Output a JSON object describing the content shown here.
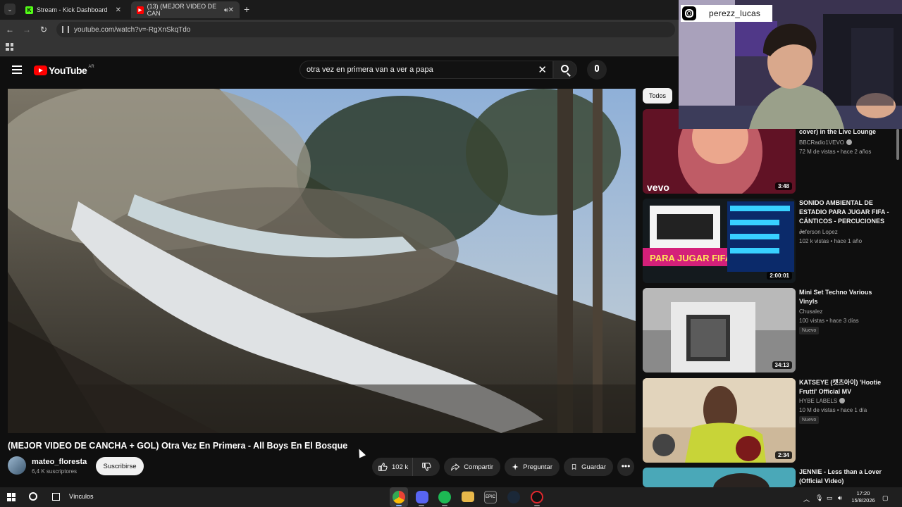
{
  "browser": {
    "tabs": [
      {
        "title": "Stream - Kick Dashboard",
        "favicon": "K",
        "active": false
      },
      {
        "title": "(13) (MEJOR VIDEO DE CAN",
        "favicon": "▶",
        "active": true
      }
    ],
    "url": "youtube.com/watch?v=-RgXnSkqTdo"
  },
  "youtube": {
    "logo_text": "YouTube",
    "country_code": "AR",
    "search_query": "otra vez en primera van a ver a papa"
  },
  "video": {
    "title": "(MEJOR VIDEO DE CANCHA + GOL) Otra Vez En Primera - All Boys En El Bosque",
    "channel": "mateo_floresta",
    "subscribers": "6,4 K suscriptores",
    "subscribe_label": "Suscribirse",
    "likes": "102 k",
    "share_label": "Compartir",
    "ask_label": "Preguntar",
    "save_label": "Guardar"
  },
  "sidebar": {
    "chip": "Todos",
    "items": [
      {
        "title": "cover) in the Live Lounge",
        "channel": "BBCRadio1VEVO",
        "verified": true,
        "meta": "72 M de vistas • hace 2 años",
        "duration": "3:48",
        "badge": "",
        "thumb_text": "vevo"
      },
      {
        "title": "SONIDO AMBIENTAL DE ESTADIO PARA JUGAR FIFA - CÁNTICOS - PERCUCIONES ...",
        "channel": "Jeferson Lopez",
        "verified": false,
        "meta": "102 k vistas • hace 1 año",
        "duration": "2:00:01",
        "badge": "",
        "thumb_text": "PARA JUGAR FIFA"
      },
      {
        "title": "Mini Set Techno Various Vinyls",
        "channel": "Chusalez",
        "verified": false,
        "meta": "100 vistas • hace 3 días",
        "duration": "34:13",
        "badge": "Nuevo",
        "thumb_text": ""
      },
      {
        "title": "KATSEYE (캣츠아이) 'Hootie Frutti' Official MV",
        "channel": "HYBE LABELS",
        "verified": true,
        "meta": "10 M de vistas • hace 1 día",
        "duration": "2:34",
        "badge": "Nuevo",
        "thumb_text": ""
      },
      {
        "title": "JENNIE - Less than a Lover (Official Video)",
        "channel": "",
        "verified": false,
        "meta": "",
        "duration": "",
        "badge": "",
        "thumb_text": ""
      }
    ]
  },
  "overlay": {
    "instagram_handle": "perezz_lucas"
  },
  "taskbar": {
    "label": "Vínculos",
    "time": "17:20",
    "date": "15/8/2026"
  },
  "colors": {
    "yt_red": "#ff0000",
    "kick_green": "#53fc18",
    "background": "#0f0f0f"
  }
}
